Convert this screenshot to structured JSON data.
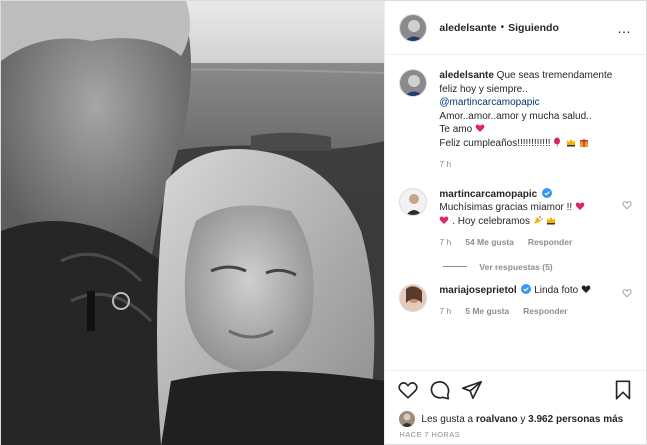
{
  "header": {
    "username": "aledelsante",
    "separator": "•",
    "follow_status": "Siguiendo",
    "more_icon": "…"
  },
  "caption": {
    "author": "aledelsante",
    "line1": "Que seas tremendamente feliz hoy y siempre..",
    "mention": "@martincarcamopapic",
    "line2": "Amor..amor..amor y mucha salud..",
    "line3": "Te amo",
    "line4": "Feliz cumpleaños!!!!!!!!!!!!",
    "time": "7 h"
  },
  "comments": [
    {
      "author": "martincarcamopapic",
      "text": "Muchísimas gracias miamor !!",
      "text2": ". Hoy celebramos",
      "time": "7 h",
      "likes": "54 Me gusta",
      "reply": "Responder",
      "view_replies": "Ver respuestas (5)"
    },
    {
      "author": "mariajoseprietol",
      "text": "Linda foto",
      "time": "7 h",
      "likes": "5 Me gusta",
      "reply": "Responder"
    }
  ],
  "likes": {
    "prefix": "Les gusta a",
    "user": "roalvano",
    "connector": "y",
    "count": "3.962 personas más"
  },
  "posted": "HACE 7 HORAS",
  "colors": {
    "heart": "#ed4956",
    "verified": "#3897f0",
    "link": "#00376b"
  }
}
